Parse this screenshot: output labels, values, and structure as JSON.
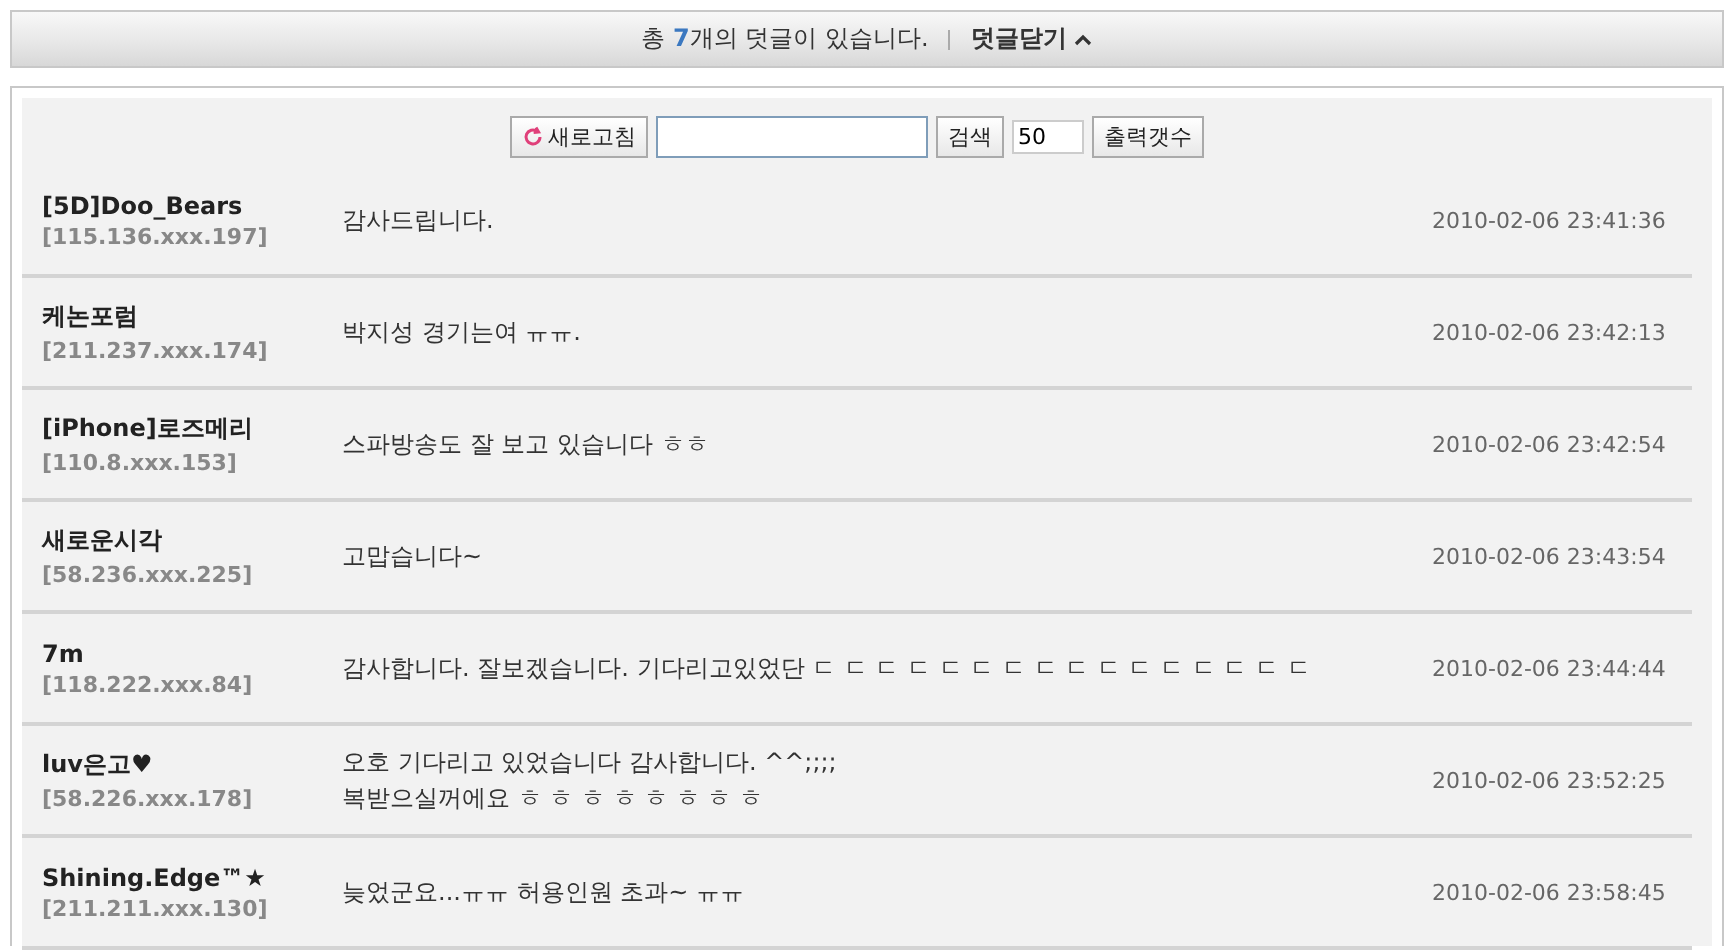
{
  "header": {
    "count_prefix": "총",
    "count": "7",
    "count_suffix": "개의 덧글이 있습니다.",
    "toggle_label": "덧글닫기",
    "toggle_expanded": true
  },
  "toolbar": {
    "refresh_button": "새로고침",
    "search_button": "검색",
    "page_size": "50",
    "page_size_button": "출력갯수"
  },
  "comments": [
    {
      "author": "[5D]Doo_Bears",
      "ip": "[115.136.xxx.197]",
      "lines": [
        "감사드립니다."
      ],
      "time": "2010-02-06 23:41:36"
    },
    {
      "author": "케논포럼",
      "ip": "[211.237.xxx.174]",
      "lines": [
        "박지성 경기는여 ㅠㅠ."
      ],
      "time": "2010-02-06 23:42:13"
    },
    {
      "author": "[iPhone]로즈메리",
      "ip": "[110.8.xxx.153]",
      "lines": [
        "스파방송도 잘 보고 있습니다 ㅎㅎ"
      ],
      "time": "2010-02-06 23:42:54"
    },
    {
      "author": "새로운시각",
      "ip": "[58.236.xxx.225]",
      "lines": [
        "고맙습니다~"
      ],
      "time": "2010-02-06 23:43:54"
    },
    {
      "author": "7m",
      "ip": "[118.222.xxx.84]",
      "lines": [
        "감사합니다. 잘보겠습니다. 기다리고있었단 ㄷ ㄷ ㄷ ㄷ ㄷ ㄷ ㄷ ㄷ ㄷ ㄷ ㄷ ㄷ ㄷ ㄷ ㄷ ㄷ"
      ],
      "time": "2010-02-06 23:44:44"
    },
    {
      "author": "luv은고♥",
      "ip": "[58.226.xxx.178]",
      "lines": [
        "오호 기다리고 있었습니다 감사합니다. ^^;;;;",
        "복받으실꺼에요 ㅎ ㅎ ㅎ ㅎ ㅎ ㅎ ㅎ ㅎ"
      ],
      "time": "2010-02-06 23:52:25"
    },
    {
      "author": "Shining.Edge™★",
      "ip": "[211.211.xxx.130]",
      "lines": [
        "늦었군요...ㅠㅠ 허용인원 초과~ ㅠㅠ"
      ],
      "time": "2010-02-06 23:58:45"
    }
  ]
}
